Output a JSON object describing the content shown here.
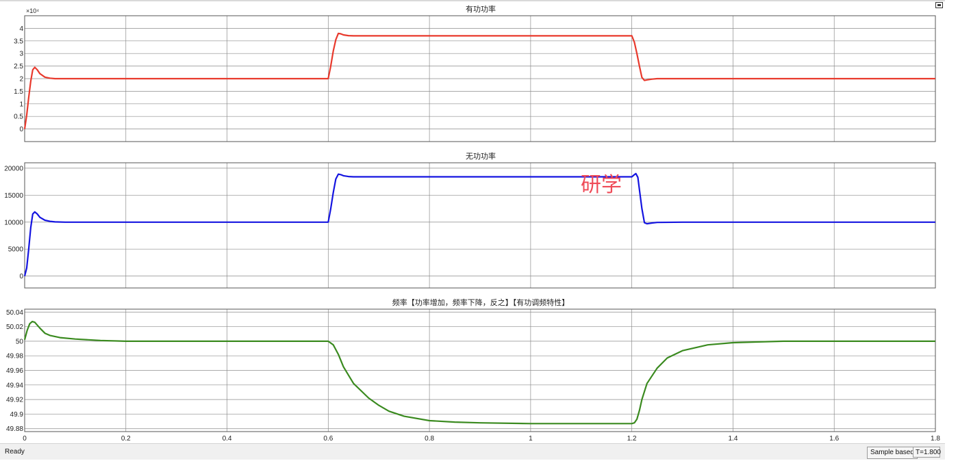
{
  "watermark": {
    "text": "研学"
  },
  "status_bar": {
    "status": "Ready",
    "sample_mode": "Sample based",
    "time": "T=1.800"
  },
  "chart_data": [
    {
      "type": "line",
      "title": "有功功率",
      "xlim": [
        0,
        1.8
      ],
      "ylim": [
        -0.5,
        4.5
      ],
      "y_exponent_label": "×10⁴",
      "x_ticks": [
        0,
        0.2,
        0.4,
        0.6,
        0.8,
        1.0,
        1.2,
        1.4,
        1.6,
        1.8
      ],
      "x_tick_labels": [
        "",
        "",
        "",
        "",
        "",
        "",
        "",
        "",
        "",
        ""
      ],
      "y_ticks": [
        0,
        0.5,
        1,
        1.5,
        2,
        2.5,
        3,
        3.5,
        4
      ],
      "y_tick_labels": [
        "0",
        "0.5",
        "1",
        "1.5",
        "2",
        "2.5",
        "3",
        "3.5",
        "4"
      ],
      "grid": true,
      "series": [
        {
          "color": "#e8392c",
          "x": [
            0,
            0.004,
            0.008,
            0.012,
            0.016,
            0.02,
            0.025,
            0.03,
            0.04,
            0.05,
            0.06,
            0.08,
            0.1,
            0.6,
            0.605,
            0.61,
            0.615,
            0.62,
            0.625,
            0.63,
            0.64,
            0.65,
            0.7,
            1.2,
            1.205,
            1.21,
            1.215,
            1.22,
            1.225,
            1.23,
            1.24,
            1.25,
            1.3,
            1.8
          ],
          "values": [
            0,
            0.55,
            1.25,
            1.9,
            2.35,
            2.45,
            2.35,
            2.2,
            2.06,
            2.02,
            2.0,
            2.0,
            2.0,
            2.0,
            2.5,
            3.1,
            3.55,
            3.8,
            3.78,
            3.74,
            3.71,
            3.7,
            3.7,
            3.7,
            3.45,
            3.0,
            2.5,
            2.05,
            1.93,
            1.95,
            1.98,
            2.0,
            2.0,
            2.0
          ]
        }
      ]
    },
    {
      "type": "line",
      "title": "无功功率",
      "xlim": [
        0,
        1.8
      ],
      "ylim": [
        -2200,
        21000
      ],
      "x_ticks": [
        0,
        0.2,
        0.4,
        0.6,
        0.8,
        1.0,
        1.2,
        1.4,
        1.6,
        1.8
      ],
      "x_tick_labels": [
        "",
        "",
        "",
        "",
        "",
        "",
        "",
        "",
        "",
        ""
      ],
      "y_ticks": [
        0,
        5000,
        10000,
        15000,
        20000
      ],
      "y_tick_labels": [
        "0",
        "5000",
        "10000",
        "15000",
        "20000"
      ],
      "grid": true,
      "series": [
        {
          "color": "#1414e0",
          "x": [
            0,
            0.004,
            0.008,
            0.012,
            0.016,
            0.02,
            0.025,
            0.03,
            0.04,
            0.05,
            0.06,
            0.08,
            0.1,
            0.6,
            0.605,
            0.61,
            0.615,
            0.62,
            0.625,
            0.63,
            0.64,
            0.65,
            0.7,
            1.2,
            1.205,
            1.208,
            1.212,
            1.215,
            1.22,
            1.225,
            1.23,
            1.24,
            1.25,
            1.3,
            1.8
          ],
          "values": [
            0,
            1500,
            5000,
            9000,
            11500,
            11900,
            11500,
            10900,
            10350,
            10150,
            10050,
            10000,
            10000,
            10000,
            12500,
            15500,
            18000,
            18900,
            18800,
            18600,
            18450,
            18400,
            18400,
            18400,
            18800,
            19000,
            18300,
            16000,
            12500,
            9900,
            9700,
            9850,
            9950,
            10000,
            10000
          ]
        }
      ]
    },
    {
      "type": "line",
      "title": "频率【功率增加，频率下降，反之】【有功调频特性】",
      "xlim": [
        0,
        1.8
      ],
      "ylim": [
        49.876,
        50.044
      ],
      "x_ticks": [
        0,
        0.2,
        0.4,
        0.6,
        0.8,
        1.0,
        1.2,
        1.4,
        1.6,
        1.8
      ],
      "x_tick_labels": [
        "0",
        "0.2",
        "0.4",
        "0.6",
        "0.8",
        "1",
        "1.2",
        "1.4",
        "1.6",
        "1.8"
      ],
      "y_ticks": [
        49.88,
        49.9,
        49.92,
        49.94,
        49.96,
        49.98,
        50,
        50.02,
        50.04
      ],
      "y_tick_labels": [
        "49.88",
        "49.9",
        "49.92",
        "49.94",
        "49.96",
        "49.98",
        "50",
        "50.02",
        "50.04"
      ],
      "grid": true,
      "series": [
        {
          "color": "#3a8a1f",
          "x": [
            0,
            0.005,
            0.01,
            0.015,
            0.02,
            0.03,
            0.04,
            0.05,
            0.07,
            0.1,
            0.15,
            0.2,
            0.6,
            0.61,
            0.62,
            0.63,
            0.65,
            0.68,
            0.7,
            0.72,
            0.75,
            0.8,
            0.85,
            0.9,
            1.0,
            1.1,
            1.2,
            1.205,
            1.21,
            1.215,
            1.22,
            1.23,
            1.25,
            1.27,
            1.3,
            1.35,
            1.4,
            1.45,
            1.5,
            1.6,
            1.8
          ],
          "values": [
            50.002,
            50.015,
            50.024,
            50.027,
            50.026,
            50.018,
            50.011,
            50.008,
            50.005,
            50.003,
            50.001,
            50.0,
            50.0,
            49.995,
            49.982,
            49.965,
            49.942,
            49.922,
            49.912,
            49.904,
            49.897,
            49.891,
            49.889,
            49.888,
            49.887,
            49.887,
            49.887,
            49.888,
            49.893,
            49.905,
            49.92,
            49.942,
            49.963,
            49.977,
            49.987,
            49.995,
            49.998,
            49.999,
            50.0,
            50.0,
            50.0
          ]
        }
      ]
    }
  ]
}
